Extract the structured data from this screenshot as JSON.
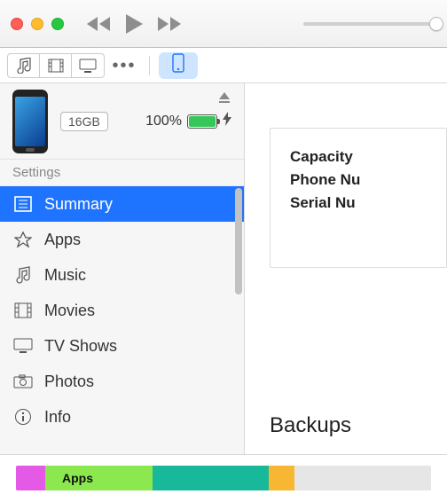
{
  "device": {
    "capacity_badge": "16GB",
    "battery_text": "100%",
    "eject_icon": "eject"
  },
  "sidebar": {
    "section_label": "Settings",
    "items": [
      {
        "label": "Summary",
        "icon": "summary",
        "selected": true
      },
      {
        "label": "Apps",
        "icon": "apps"
      },
      {
        "label": "Music",
        "icon": "music"
      },
      {
        "label": "Movies",
        "icon": "movies"
      },
      {
        "label": "TV Shows",
        "icon": "tv"
      },
      {
        "label": "Photos",
        "icon": "photos"
      },
      {
        "label": "Info",
        "icon": "info"
      }
    ]
  },
  "panel": {
    "capacity_label": "Capacity",
    "phone_label": "Phone Nu",
    "serial_label": "Serial Nu"
  },
  "backups_title": "Backups",
  "storage": {
    "segments": [
      {
        "name": "audio",
        "color": "#e459e6",
        "pct": 7
      },
      {
        "name": "apps",
        "color": "#8be84f",
        "pct": 26,
        "label": "Apps"
      },
      {
        "name": "docs",
        "color": "#18b89a",
        "pct": 28
      },
      {
        "name": "other",
        "color": "#f7b733",
        "pct": 6
      },
      {
        "name": "free",
        "color": "#e6e6e6",
        "pct": 33
      }
    ]
  }
}
